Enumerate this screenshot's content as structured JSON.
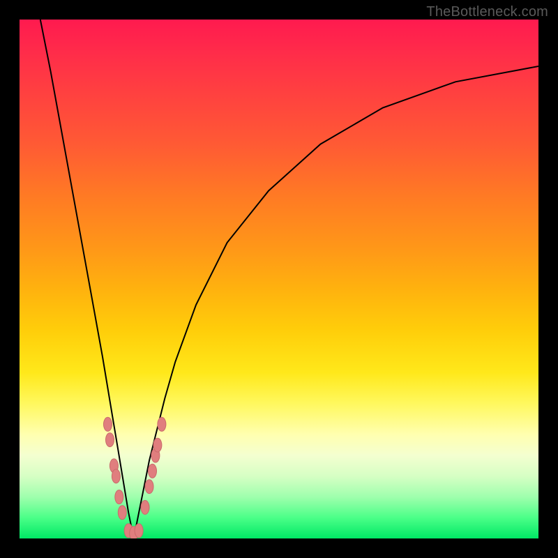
{
  "watermark": {
    "text": "TheBottleneck.com"
  },
  "colors": {
    "frame": "#000000",
    "curve": "#000000",
    "marker_fill": "#e07e7e",
    "marker_stroke": "#c96a6a",
    "gradient_top": "#ff1a4f",
    "gradient_bottom": "#00e865"
  },
  "chart_data": {
    "type": "line",
    "title": "",
    "xlabel": "",
    "ylabel": "",
    "xlim": [
      0,
      100
    ],
    "ylim": [
      0,
      100
    ],
    "note": "Axes are unlabeled; values are read in 0–100 percent of the plot width/height. y=0 is the bottom (green). The black curve forms a V reaching y≈0 near x≈22 and rising steeply on both sides.",
    "series": [
      {
        "name": "bottleneck-curve",
        "color": "#000000",
        "x": [
          4,
          6,
          8,
          10,
          12,
          14,
          16,
          18,
          19,
          20,
          21,
          22,
          23,
          24,
          25,
          26,
          28,
          30,
          34,
          40,
          48,
          58,
          70,
          84,
          100
        ],
        "y": [
          100,
          90,
          79,
          68,
          57,
          46,
          35,
          23,
          17,
          11,
          5,
          0,
          5,
          10,
          15,
          19,
          27,
          34,
          45,
          57,
          67,
          76,
          83,
          88,
          91
        ]
      }
    ],
    "markers": {
      "name": "sample-points",
      "color": "#e07e7e",
      "note": "Pink oval markers clustered on both arms near the dip; y≤~22.",
      "points": [
        {
          "x": 17.0,
          "y": 22
        },
        {
          "x": 17.4,
          "y": 19
        },
        {
          "x": 18.2,
          "y": 14
        },
        {
          "x": 18.6,
          "y": 12
        },
        {
          "x": 19.2,
          "y": 8
        },
        {
          "x": 19.8,
          "y": 5
        },
        {
          "x": 21.0,
          "y": 1.5
        },
        {
          "x": 22.0,
          "y": 1.0
        },
        {
          "x": 23.0,
          "y": 1.5
        },
        {
          "x": 24.2,
          "y": 6
        },
        {
          "x": 25.0,
          "y": 10
        },
        {
          "x": 25.6,
          "y": 13
        },
        {
          "x": 26.2,
          "y": 16
        },
        {
          "x": 26.6,
          "y": 18
        },
        {
          "x": 27.4,
          "y": 22
        }
      ]
    }
  }
}
